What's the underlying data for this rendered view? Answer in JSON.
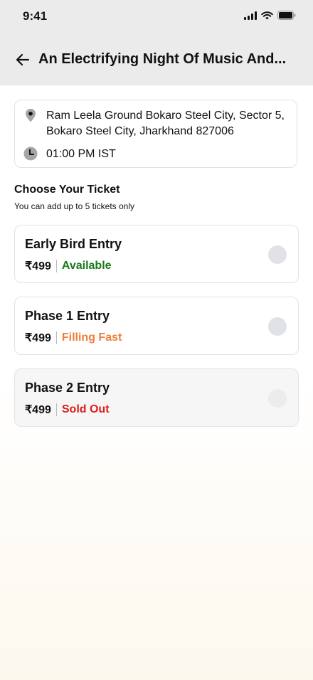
{
  "status_bar": {
    "time": "9:41"
  },
  "header": {
    "title": "An Electrifying Night Of Music And..."
  },
  "event": {
    "address": "Ram Leela Ground Bokaro Steel City, Sector 5, Bokaro Steel City, Jharkhand 827006",
    "time": "01:00 PM IST"
  },
  "section": {
    "title": "Choose Your Ticket",
    "subtitle": "You can add up to 5 tickets only"
  },
  "tickets": [
    {
      "name": "Early Bird Entry",
      "price": "₹499",
      "status": "Available",
      "status_color": "#1a7a1a"
    },
    {
      "name": "Phase 1 Entry",
      "price": "₹499",
      "status": "Filling Fast",
      "status_color": "#f07d3a"
    },
    {
      "name": "Phase 2 Entry",
      "price": "₹499",
      "status": "Sold Out",
      "status_color": "#e01b1b"
    }
  ]
}
